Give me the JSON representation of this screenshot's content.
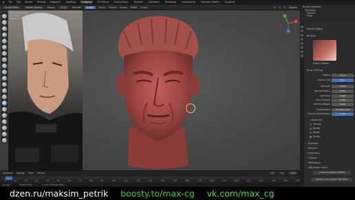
{
  "menu": [
    "File",
    "Edit",
    "Render",
    "Window",
    "Help"
  ],
  "workspaces": [
    "Layout",
    "Modeling",
    "Sculpting",
    "UV Editing",
    "Texture Paint",
    "Shading",
    "Animation",
    "Rendering",
    "Compositing",
    "Geometry Nodes",
    "Scripting"
  ],
  "active_workspace": "Sculpting",
  "tool_header": {
    "tool": "Elastic Deform",
    "mode": "Sculpt Mode",
    "radius_label": "Radius",
    "radius_value": "32 px",
    "strength_label": "Strength",
    "strength_value": "0.200",
    "menus": [
      "Brush",
      "Texture",
      "Stroke",
      "Falloff",
      "Cursor"
    ],
    "symmetry": [
      "X",
      "Y",
      "Z"
    ],
    "options": "Options"
  },
  "viewport": {
    "overlay_title": "User Perspective",
    "overlay_object": "(1) Head",
    "statistics": "Objects  1/1"
  },
  "timeline": {
    "menus": [
      "Playback",
      "Keying",
      "View",
      "Marker"
    ],
    "frame_numbers": [
      "0",
      "10",
      "20",
      "30",
      "40",
      "50",
      "60",
      "70",
      "80",
      "90",
      "100",
      "110",
      "120",
      "130",
      "140",
      "150",
      "160",
      "170",
      "180",
      "190",
      "200",
      "210",
      "220",
      "230",
      "240",
      "250"
    ],
    "current_frame": "1",
    "start": "1",
    "end": "250"
  },
  "statusbar": {
    "left": "Sculpt",
    "mid": "Rotate View",
    "right": "Sculpt Context Menu"
  },
  "outliner": {
    "title": "Scene Collection",
    "items": [
      "Collection",
      "Camera",
      "Head"
    ]
  },
  "properties": {
    "brush_name": "Elastic Deform",
    "section_brushes": "Brushes",
    "section_settings": "Brush Settings",
    "fields": [
      {
        "label": "Radius",
        "value": "32 px"
      },
      {
        "label": "Radius Unit",
        "value": "View"
      },
      {
        "label": "Strength",
        "value": "0.200"
      },
      {
        "label": "Normal Radius",
        "value": "0.500"
      },
      {
        "label": "Hardness",
        "value": "0.000"
      },
      {
        "label": "Auto-Smooth",
        "value": "0.000"
      },
      {
        "label": "Normal Weight",
        "value": "0.000"
      }
    ],
    "deformation_label": "Deformation",
    "deformation_value": "Tri-Scale Grab",
    "volume_label": "Volume Preservation",
    "volume_value": "0.400",
    "subpanels": [
      "Advanced",
      "Texture",
      "Stroke",
      "Falloff",
      "Cursor"
    ],
    "panels": [
      "Dyntopo",
      "Remesh",
      "Symmetry",
      "Options",
      "Workspace",
      "OBJ Vertex Colors"
    ],
    "create_button": "Create Sculpting Palette",
    "bottom_button": "Sample and Create OBJ Mask"
  },
  "banner": {
    "link1": "dzen.ru/maksim_petrik",
    "link2": "boosty.to/max-cg",
    "link3": "vk.com/max_cg",
    "color1": "#ffffff",
    "color2": "#3fd23f",
    "color3": "#4fe04f"
  }
}
